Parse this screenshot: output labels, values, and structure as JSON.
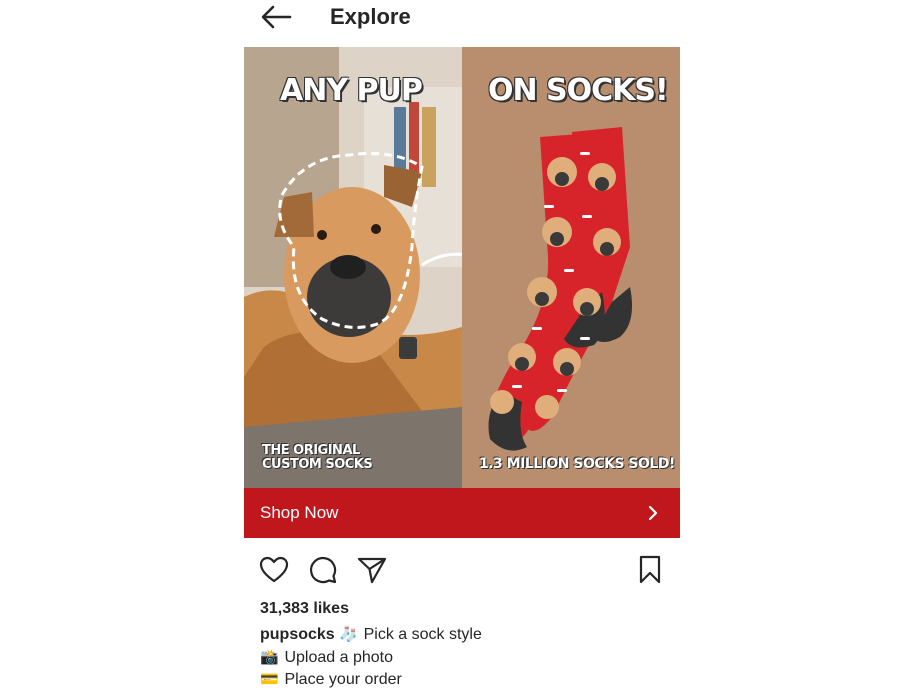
{
  "header": {
    "title": "Explore",
    "back_icon": "arrow-left-icon"
  },
  "ad": {
    "left_caption": "ANY PUP",
    "right_caption": "ON SOCKS!",
    "badge_line1": "THE ORIGINAL",
    "badge_line2": "CUSTOM SOCKS",
    "sold_text": "1.3 MILLION SOCKS SOLD!",
    "sock_color": "#d6242a",
    "panel_color": "#b88e6e"
  },
  "cta": {
    "label": "Shop Now",
    "icon": "chevron-right-icon",
    "color": "#c0171c"
  },
  "actions": {
    "like_icon": "heart-icon",
    "comment_icon": "comment-icon",
    "share_icon": "send-icon",
    "save_icon": "bookmark-icon"
  },
  "post": {
    "likes": "31,383 likes",
    "username": "pupsocks",
    "caption_lines": [
      {
        "emoji": "🧦",
        "text": "Pick a sock style"
      },
      {
        "emoji": "📸",
        "text": "Upload a photo"
      },
      {
        "emoji": "💳",
        "text": "Place your order"
      }
    ]
  }
}
